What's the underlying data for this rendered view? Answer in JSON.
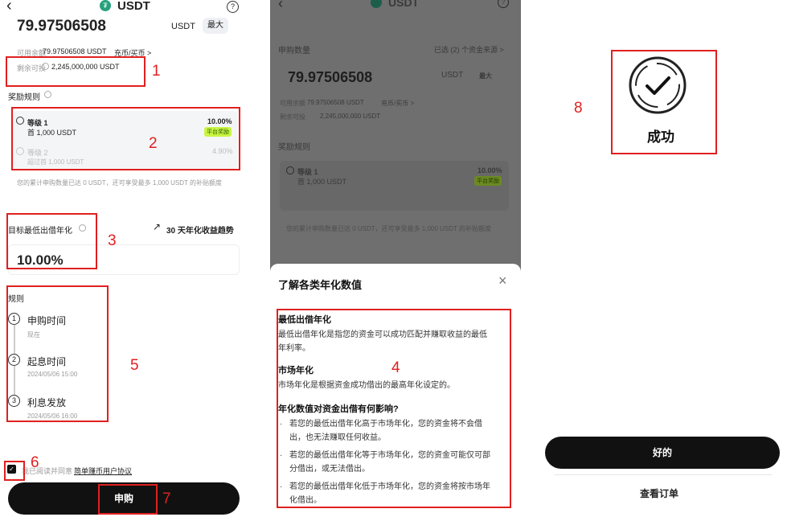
{
  "header": {
    "back_glyph": "‹",
    "title": "USDT",
    "help_glyph": "?"
  },
  "panel1": {
    "amount": "79.97506508",
    "currency": "USDT",
    "max_label": "最大",
    "available_label": "可用余额",
    "available_value": "79.97506508 USDT",
    "deposit_link": "充币/买币 >",
    "remaining_label": "剩余可投",
    "remaining_value": "2,245,000,000 USDT",
    "rewards_title": "奖励规则",
    "tier1_label": "等级 1",
    "tier1_range": "首 1,000 USDT",
    "tier1_rate": "10.00%",
    "tier1_badge": "平台奖励",
    "tier2_label": "等级 2",
    "tier2_range": "超过首 1,000 USDT",
    "tier2_rate": "4.90%",
    "reward_note": "您的累计申购数量已达 0 USDT，还可享受最多 1,000 USDT 的补贴额度",
    "min_rate_label": "目标最低出借年化",
    "trend_label": "30 天年化收益趋势",
    "min_rate_value": "10.00%",
    "rules_title": "规则",
    "steps": [
      {
        "num": "1",
        "title": "申购时间",
        "sub": "现在"
      },
      {
        "num": "2",
        "title": "起息时间",
        "sub": "2024/05/06 15:00"
      },
      {
        "num": "3",
        "title": "利息发放",
        "sub": "2024/05/06 16:00"
      }
    ],
    "agree_prefix": "我已阅读并同意",
    "agree_link": "简单赚币用户协议",
    "subscribe_button": "申购"
  },
  "panel2": {
    "amount_label": "申购数量",
    "source_label": "已选 (2) 个资金来源 >",
    "amount": "79.97506508",
    "currency": "USDT",
    "max_label": "最大",
    "available_label": "可用余额",
    "available_value": "79.97506508 USDT",
    "deposit_link": "充币/买币 >",
    "remaining_label": "剩余可投",
    "remaining_value": "2,245,000,000 USDT",
    "rewards_title": "奖励规则",
    "tier1_label": "等级 1",
    "tier1_range": "首 1,000 USDT",
    "tier1_rate": "10.00%",
    "tier1_badge": "平台奖励",
    "reward_note": "您的累计申购数量已达 0 USDT，还可享受最多 1,000 USDT 的补贴额度",
    "sheet": {
      "title": "了解各类年化数值",
      "close_glyph": "×",
      "h1": "最低出借年化",
      "p1a": "最低出借年化是指您的资金可以成功匹配并赚取收益的最低",
      "p1b": "年利率。",
      "h2": "市场年化",
      "p2": "市场年化是根据资金成功借出的最高年化设定的。",
      "h3": "年化数值对资金出借有何影响?",
      "b1a": "若您的最低出借年化高于市场年化，您的资金将不会借",
      "b1b": "出，也无法赚取任何收益。",
      "b2a": "若您的最低出借年化等于市场年化，您的资金可能仅可部",
      "b2b": "分借出，或无法借出。",
      "b3a": "若您的最低出借年化低于市场年化，您的资金将按市场年",
      "b3b": "化借出。",
      "bullet": "·"
    }
  },
  "panel3": {
    "success_text": "成功",
    "ok_button": "好的",
    "view_orders": "查看订单"
  },
  "annotations": [
    "1",
    "2",
    "3",
    "4",
    "5",
    "6",
    "7",
    "8"
  ],
  "colors": {
    "annotation_red": "#e02020",
    "badge_green": "#c9f542",
    "button_dark": "#111111"
  }
}
